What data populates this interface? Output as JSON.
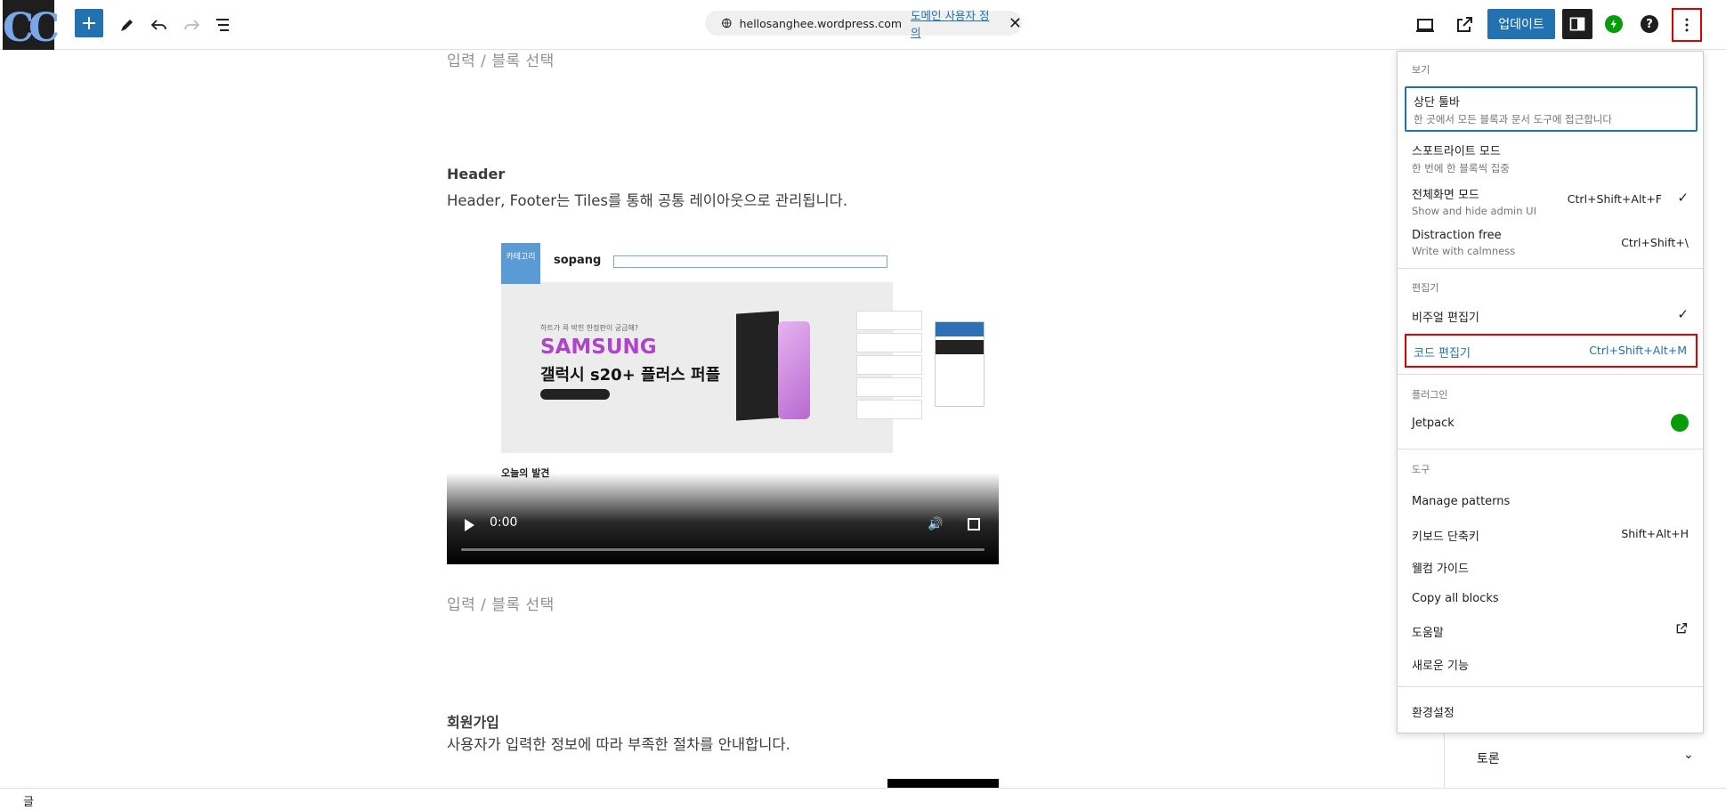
{
  "topbar": {
    "logo_text": "CC",
    "site_domain": "hellosanghee.wordpress.com",
    "domain_link": "도메인 사용자 정의",
    "update_label": "업데이트",
    "help_label": "?"
  },
  "content": {
    "placeholder_top": "입력 / 블록 선택",
    "header_title": "Header",
    "header_desc": "Header, Footer는 Tiles를 통해 공통 레이아웃으로 관리됩니다.",
    "video": {
      "menu_label": "카테고리",
      "brand": "sopang",
      "promo_line": "하트가 콕 박힌 한정판이 궁금해?",
      "promo_brand": "SAMSUNG",
      "promo_model": "갤럭시 s20+ 플러스 퍼플",
      "section_title": "오늘의 발견",
      "time": "0:00"
    },
    "placeholder_mid": "입력 / 블록 선택",
    "signup_title": "회원가입",
    "signup_desc": "사용자가 입력한 정보에 따라 부족한 절차를 안내합니다."
  },
  "statusbar": {
    "label": "글"
  },
  "sidebar": {
    "discussion_label": "토론"
  },
  "menu": {
    "view_label": "보기",
    "top_toolbar": {
      "title": "상단 툴바",
      "desc": "한 곳에서 모든 블록과 문서 도구에 접근합니다"
    },
    "spotlight": {
      "title": "스포트라이트 모드",
      "desc": "한 번에 한 블록씩 집중"
    },
    "fullscreen": {
      "title": "전체화면 모드",
      "desc": "Show and hide admin UI",
      "shortcut": "Ctrl+Shift+Alt+F"
    },
    "distraction": {
      "title": "Distraction free",
      "desc": "Write with calmness",
      "shortcut": "Ctrl+Shift+\\"
    },
    "editor_label": "편집기",
    "visual_editor": {
      "title": "비주얼 편집기"
    },
    "code_editor": {
      "title": "코드 편집기",
      "shortcut": "Ctrl+Shift+Alt+M"
    },
    "plugins_label": "플러그인",
    "jetpack": {
      "title": "Jetpack"
    },
    "tools_label": "도구",
    "manage_patterns": "Manage patterns",
    "keyboard_shortcuts": {
      "title": "키보드 단축키",
      "shortcut": "Shift+Alt+H"
    },
    "welcome_guide": "웰컴 가이드",
    "copy_all_blocks": "Copy all blocks",
    "help": "도움말",
    "whats_new": "새로운 기능",
    "preferences": "환경설정",
    "check_mark": "✓"
  }
}
